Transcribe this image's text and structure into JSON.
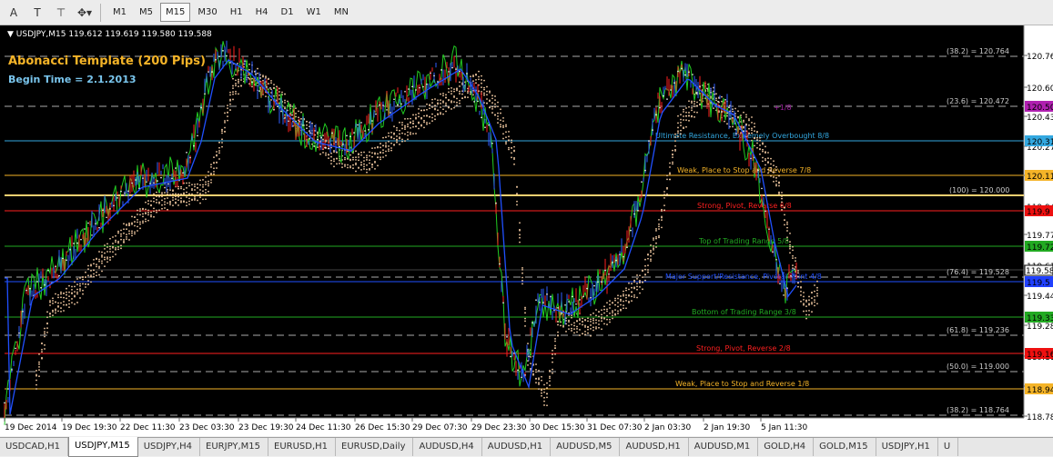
{
  "toolbar": {
    "icons": [
      {
        "name": "text-label-icon",
        "glyph": "A"
      },
      {
        "name": "text-icon",
        "glyph": "T"
      },
      {
        "name": "label-tool-icon",
        "glyph": "⊤"
      },
      {
        "name": "arrows-dropdown-icon",
        "glyph": "✥▾"
      }
    ],
    "timeframes": [
      "M1",
      "M5",
      "M15",
      "M30",
      "H1",
      "H4",
      "D1",
      "W1",
      "MN"
    ],
    "active_timeframe": "M15"
  },
  "chart": {
    "title": "▼ USDJPY,M15  119.612 119.619 119.580 119.588",
    "template_title": "Abonacci Template (200 Pips)",
    "begin_time": "Begin Time = 2.1.2013",
    "price_axis": [
      "120.765",
      "120.605",
      "120.435",
      "120.270",
      "120.110",
      "119.945",
      "119.775",
      "119.610",
      "119.445",
      "119.280",
      "119.115",
      "118.950",
      "118.785"
    ],
    "current_price": "119.588",
    "colors": {
      "background": "#000000",
      "green": "#22cc22",
      "red": "#ff2020",
      "blue": "#2050ff",
      "white": "#ffffff",
      "gold": "#f5b428",
      "cyan": "#33a8e0",
      "magenta": "#a020a0"
    }
  },
  "levels": [
    {
      "label": "(38.2) = 120.764",
      "color": "#cccccc",
      "style": "dashed"
    },
    {
      "label": "(23.6) = 120.472",
      "color": "#cccccc",
      "style": "dashed",
      "murrey": "+1/8",
      "murrey_color": "#a020a0",
      "tag": "120.50",
      "tag_color": "#b020b0"
    },
    {
      "label": "Ultimate Resistance, Extremely Overbought  8/8",
      "color": "#33a8e0",
      "tag": "120.31",
      "tag_color": "#33a8e0"
    },
    {
      "label": "Weak, Place to Stop and Reverse  7/8",
      "color": "#f5b428",
      "tag": "120.11",
      "tag_color": "#f5b428"
    },
    {
      "label": "(100) = 120.000",
      "color": "#cccccc",
      "style": "solid-gold"
    },
    {
      "label": "Strong, Pivot, Reverse  6/8",
      "color": "#ff2020",
      "tag": "119.9",
      "tag_color": "#ee1010"
    },
    {
      "label": "Top of Trading Range  5/8",
      "color": "#22aa22",
      "tag": "119.72",
      "tag_color": "#22aa22"
    },
    {
      "label": "(76.4) = 119.528",
      "color": "#cccccc",
      "style": "dashed"
    },
    {
      "label": "Major Support/Resistance, Pivotal Point  4/8",
      "color": "#2050ff",
      "tag": "119.5",
      "tag_color": "#2040ff"
    },
    {
      "label": "Bottom of Trading Range  3/8",
      "color": "#22aa22",
      "tag": "119.33",
      "tag_color": "#22aa22"
    },
    {
      "label": "(61.8) = 119.236",
      "color": "#cccccc",
      "style": "dashed"
    },
    {
      "label": "Strong, Pivot, Reverse  2/8",
      "color": "#ff2020",
      "tag": "119.16",
      "tag_color": "#ee1010"
    },
    {
      "label": "(50.0) = 119.000",
      "color": "#cccccc",
      "style": "dashed"
    },
    {
      "label": "Weak, Place to Stop and Reverse  1/8",
      "color": "#f5b428",
      "tag": "118.94",
      "tag_color": "#f5b428"
    },
    {
      "label": "(38.2) = 118.764",
      "color": "#cccccc",
      "style": "dashed"
    }
  ],
  "time_axis": [
    "19 Dec 2014",
    "19 Dec 19:30",
    "22 Dec 11:30",
    "23 Dec 03:30",
    "23 Dec 19:30",
    "24 Dec 11:30",
    "26 Dec 15:30",
    "29 Dec 07:30",
    "29 Dec 23:30",
    "30 Dec 15:30",
    "31 Dec 07:30",
    "2 Jan 03:30",
    "2 Jan 19:30",
    "5 Jan 11:30"
  ],
  "tabs": [
    "USDCAD,H1",
    "USDJPY,M15",
    "USDJPY,H4",
    "EURJPY,M15",
    "EURUSD,H1",
    "EURUSD,Daily",
    "AUDUSD,H4",
    "AUDUSD,H1",
    "AUDUSD,M5",
    "AUDUSD,H1",
    "AUDUSD,M1",
    "GOLD,H4",
    "GOLD,M15",
    "USDJPY,H1",
    "U"
  ],
  "active_tab": "USDJPY,M15"
}
